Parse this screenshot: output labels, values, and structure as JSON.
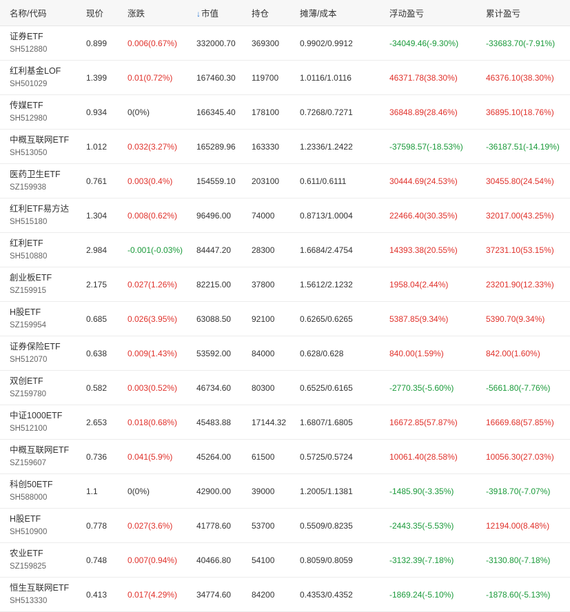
{
  "header": {
    "name": "名称/代码",
    "price": "现价",
    "change": "涨跌",
    "sort_icon": "↓",
    "market_value": "市值",
    "position": "持仓",
    "cost": "摊薄/成本",
    "floating_pl": "浮动盈亏",
    "cumulative_pl": "累计盈亏"
  },
  "colors": {
    "gain": "#e0312b",
    "loss": "#1a9a3a",
    "header_bg": "#f7f7f7"
  },
  "rows": [
    {
      "name": "证券ETF",
      "code": "SH512880",
      "price": "0.899",
      "change": "0.006(0.67%)",
      "change_dir": "pos",
      "mv": "332000.70",
      "pos": "369300",
      "cost": "0.9902/0.9912",
      "fpl": "-34049.46(-9.30%)",
      "fpl_dir": "neg",
      "cpl": "-33683.70(-7.91%)",
      "cpl_dir": "neg"
    },
    {
      "name": "红利基金LOF",
      "code": "SH501029",
      "price": "1.399",
      "change": "0.01(0.72%)",
      "change_dir": "pos",
      "mv": "167460.30",
      "pos": "119700",
      "cost": "1.0116/1.0116",
      "fpl": "46371.78(38.30%)",
      "fpl_dir": "pos",
      "cpl": "46376.10(38.30%)",
      "cpl_dir": "pos"
    },
    {
      "name": "传媒ETF",
      "code": "SH512980",
      "price": "0.934",
      "change": "0(0%)",
      "change_dir": "flat",
      "mv": "166345.40",
      "pos": "178100",
      "cost": "0.7268/0.7271",
      "fpl": "36848.89(28.46%)",
      "fpl_dir": "pos",
      "cpl": "36895.10(18.76%)",
      "cpl_dir": "pos"
    },
    {
      "name": "中概互联网ETF",
      "code": "SH513050",
      "price": "1.012",
      "change": "0.032(3.27%)",
      "change_dir": "pos",
      "mv": "165289.96",
      "pos": "163330",
      "cost": "1.2336/1.2422",
      "fpl": "-37598.57(-18.53%)",
      "fpl_dir": "neg",
      "cpl": "-36187.51(-14.19%)",
      "cpl_dir": "neg"
    },
    {
      "name": "医药卫生ETF",
      "code": "SZ159938",
      "price": "0.761",
      "change": "0.003(0.4%)",
      "change_dir": "pos",
      "mv": "154559.10",
      "pos": "203100",
      "cost": "0.611/0.6111",
      "fpl": "30444.69(24.53%)",
      "fpl_dir": "pos",
      "cpl": "30455.80(24.54%)",
      "cpl_dir": "pos"
    },
    {
      "name": "红利ETF易方达",
      "code": "SH515180",
      "price": "1.304",
      "change": "0.008(0.62%)",
      "change_dir": "pos",
      "mv": "96496.00",
      "pos": "74000",
      "cost": "0.8713/1.0004",
      "fpl": "22466.40(30.35%)",
      "fpl_dir": "pos",
      "cpl": "32017.00(43.25%)",
      "cpl_dir": "pos"
    },
    {
      "name": "红利ETF",
      "code": "SH510880",
      "price": "2.984",
      "change": "-0.001(-0.03%)",
      "change_dir": "neg",
      "mv": "84447.20",
      "pos": "28300",
      "cost": "1.6684/2.4754",
      "fpl": "14393.38(20.55%)",
      "fpl_dir": "pos",
      "cpl": "37231.10(53.15%)",
      "cpl_dir": "pos"
    },
    {
      "name": "創业板ETF",
      "code": "SZ159915",
      "price": "2.175",
      "change": "0.027(1.26%)",
      "change_dir": "pos",
      "mv": "82215.00",
      "pos": "37800",
      "cost": "1.5612/2.1232",
      "fpl": "1958.04(2.44%)",
      "fpl_dir": "pos",
      "cpl": "23201.90(12.33%)",
      "cpl_dir": "pos"
    },
    {
      "name": "H股ETF",
      "code": "SZ159954",
      "price": "0.685",
      "change": "0.026(3.95%)",
      "change_dir": "pos",
      "mv": "63088.50",
      "pos": "92100",
      "cost": "0.6265/0.6265",
      "fpl": "5387.85(9.34%)",
      "fpl_dir": "pos",
      "cpl": "5390.70(9.34%)",
      "cpl_dir": "pos"
    },
    {
      "name": "证券保险ETF",
      "code": "SH512070",
      "price": "0.638",
      "change": "0.009(1.43%)",
      "change_dir": "pos",
      "mv": "53592.00",
      "pos": "84000",
      "cost": "0.628/0.628",
      "fpl": "840.00(1.59%)",
      "fpl_dir": "pos",
      "cpl": "842.00(1.60%)",
      "cpl_dir": "pos"
    },
    {
      "name": "双创ETF",
      "code": "SZ159780",
      "price": "0.582",
      "change": "0.003(0.52%)",
      "change_dir": "pos",
      "mv": "46734.60",
      "pos": "80300",
      "cost": "0.6525/0.6165",
      "fpl": "-2770.35(-5.60%)",
      "fpl_dir": "neg",
      "cpl": "-5661.80(-7.76%)",
      "cpl_dir": "neg"
    },
    {
      "name": "中证1000ETF",
      "code": "SH512100",
      "price": "2.653",
      "change": "0.018(0.68%)",
      "change_dir": "pos",
      "mv": "45483.88",
      "pos": "17144.32",
      "cost": "1.6807/1.6805",
      "fpl": "16672.85(57.87%)",
      "fpl_dir": "pos",
      "cpl": "16669.68(57.85%)",
      "cpl_dir": "pos"
    },
    {
      "name": "中概互联网ETF",
      "code": "SZ159607",
      "price": "0.736",
      "change": "0.041(5.9%)",
      "change_dir": "pos",
      "mv": "45264.00",
      "pos": "61500",
      "cost": "0.5725/0.5724",
      "fpl": "10061.40(28.58%)",
      "fpl_dir": "pos",
      "cpl": "10056.30(27.03%)",
      "cpl_dir": "pos"
    },
    {
      "name": "科创50ETF",
      "code": "SH588000",
      "price": "1.1",
      "change": "0(0%)",
      "change_dir": "flat",
      "mv": "42900.00",
      "pos": "39000",
      "cost": "1.2005/1.1381",
      "fpl": "-1485.90(-3.35%)",
      "fpl_dir": "neg",
      "cpl": "-3918.70(-7.07%)",
      "cpl_dir": "neg"
    },
    {
      "name": "H股ETF",
      "code": "SH510900",
      "price": "0.778",
      "change": "0.027(3.6%)",
      "change_dir": "pos",
      "mv": "41778.60",
      "pos": "53700",
      "cost": "0.5509/0.8235",
      "fpl": "-2443.35(-5.53%)",
      "fpl_dir": "neg",
      "cpl": "12194.00(8.48%)",
      "cpl_dir": "pos"
    },
    {
      "name": "农业ETF",
      "code": "SZ159825",
      "price": "0.748",
      "change": "0.007(0.94%)",
      "change_dir": "pos",
      "mv": "40466.80",
      "pos": "54100",
      "cost": "0.8059/0.8059",
      "fpl": "-3132.39(-7.18%)",
      "fpl_dir": "neg",
      "cpl": "-3130.80(-7.18%)",
      "cpl_dir": "neg"
    },
    {
      "name": "恒生互联网ETF",
      "code": "SH513330",
      "price": "0.413",
      "change": "0.017(4.29%)",
      "change_dir": "pos",
      "mv": "34774.60",
      "pos": "84200",
      "cost": "0.4353/0.4352",
      "fpl": "-1869.24(-5.10%)",
      "fpl_dir": "neg",
      "cpl": "-1878.60(-5.13%)",
      "cpl_dir": "neg"
    }
  ]
}
